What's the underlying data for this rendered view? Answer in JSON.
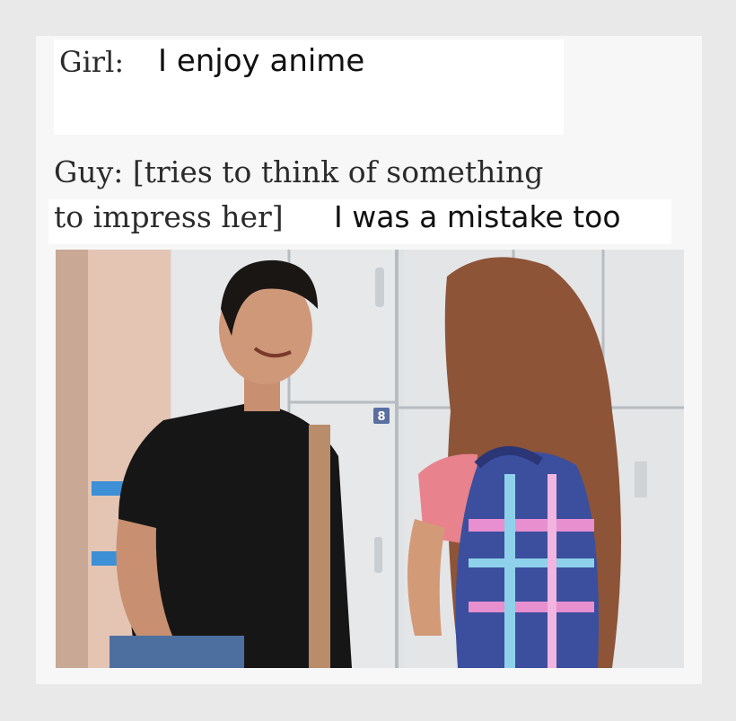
{
  "caption": {
    "girl_label": "Girl:",
    "girl_text": "I enjoy anime",
    "guy_line_1": "Guy: [tries to think of something",
    "guy_line_2": "to impress her]",
    "guy_reply": "I was a mistake too"
  },
  "photo": {
    "locker_number": "8",
    "description_icons": [
      "boy-figure",
      "girl-figure",
      "locker-bank",
      "backpack"
    ]
  }
}
